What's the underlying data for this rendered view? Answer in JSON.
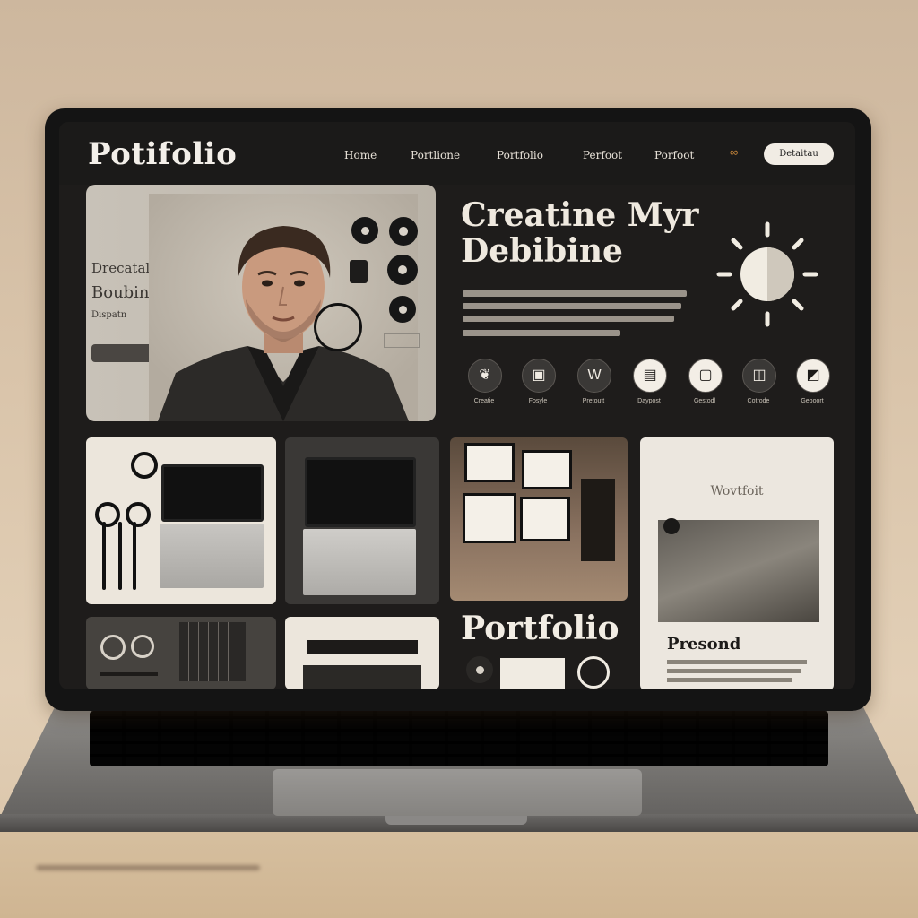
{
  "nav": {
    "logo": "Potifolio",
    "links": [
      "Home",
      "Portlione",
      "Portfolio",
      "Perfoot",
      "Porfoot"
    ],
    "cta": "Detaitau"
  },
  "hero": {
    "name_lines": [
      "Drecatal",
      "Boubin",
      "Dispatn"
    ],
    "headline_line1": "Creatine Myr",
    "headline_line2": "Debibine",
    "icon_labels": [
      "Creatie",
      "Fosyle",
      "Pretoutt",
      "Daypost",
      "Gestodl",
      "Cotrode",
      "Gepoort"
    ]
  },
  "cards": {
    "portfolio_label": "Portfolio",
    "doc_title": "Wovtfoit",
    "doc_subtitle": "Presond"
  },
  "colors": {
    "screen_bg": "#1e1c1b",
    "accent": "#c5853a",
    "cream": "#f3eee6"
  }
}
